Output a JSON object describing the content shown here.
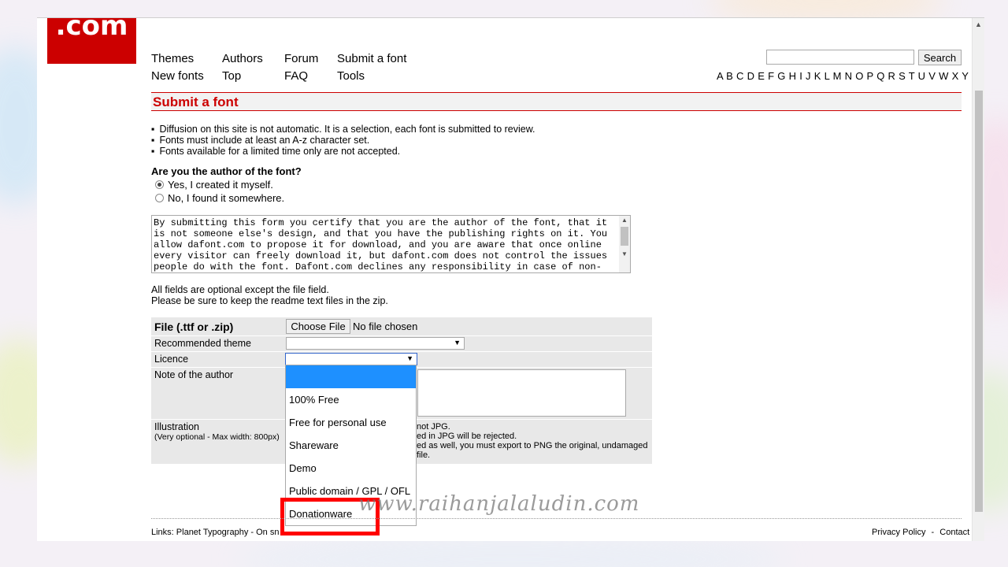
{
  "logo": {
    "text": ".com"
  },
  "nav": {
    "themes": "Themes",
    "authors": "Authors",
    "forum": "Forum",
    "submit": "Submit a font",
    "new_fonts": "New fonts",
    "top": "Top",
    "faq": "FAQ",
    "tools": "Tools"
  },
  "search": {
    "button": "Search",
    "value": ""
  },
  "alphabet": "A B C D E F G H I J K L M N O P Q R S T U V W X Y Z #",
  "page_title": "Submit a font",
  "bullets": [
    "Diffusion on this site is not automatic. It is a selection, each font is submitted to review.",
    "Fonts must include at least an A-z character set.",
    "Fonts available for a limited time only are not accepted."
  ],
  "author_question": "Are you the author of the font?",
  "author_options": [
    "Yes, I created it myself.",
    "No, I found it somewhere."
  ],
  "author_selected": 0,
  "terms_text": "By submitting this form you certify that you are the author of the font, that it is not someone else's design, and that you have the publishing rights on it. You allow dafont.com to propose it for download, and you are aware that once online every visitor can freely download it, but dafont.com does not control the issues people do with the font. Dafont.com declines any responsibility in case of non-respect by the",
  "notes": [
    "All fields are optional except the file field.",
    "Please be sure to keep the readme text files in the zip."
  ],
  "form": {
    "file_label": "File (.ttf or .zip)",
    "choose_file": "Choose File",
    "no_file": "No file chosen",
    "theme_label": "Recommended theme",
    "licence_label": "Licence",
    "note_label": "Note of the author",
    "illustration_label": "Illustration",
    "illustration_hint": "(Very optional - Max width: 800px)",
    "illustration_lines": [
      "not JPG.",
      "ed in JPG will be rejected.",
      "ed as well, you must export to PNG the original, undamaged file."
    ]
  },
  "licence_options": [
    "",
    "100% Free",
    "Free for personal use",
    "Shareware",
    "Demo",
    "Public domain / GPL / OFL",
    "Donationware"
  ],
  "footer": {
    "links": "Links:  Planet Typography  -  On sn",
    "privacy": "Privacy Policy",
    "sep": "-",
    "contact": "Contact"
  },
  "watermark": "www.raihanjalaludin.com"
}
